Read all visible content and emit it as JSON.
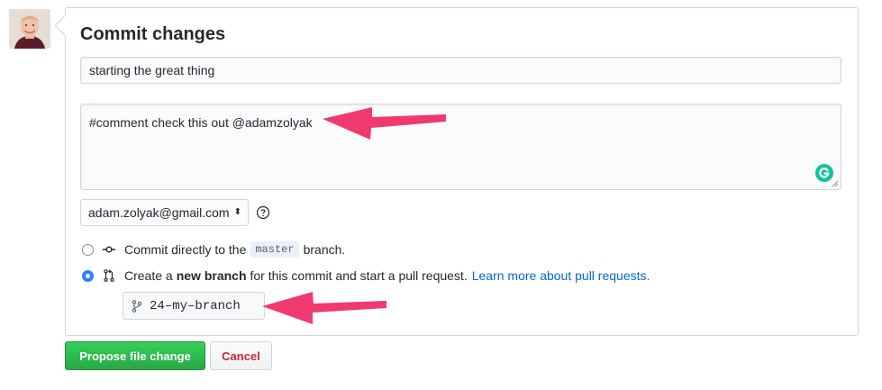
{
  "commit": {
    "title": "Commit changes",
    "summary_value": "starting the great thing",
    "description_value": "#comment check this out @adamzolyak",
    "email_value": "adam.zolyak@gmail.com",
    "email_caret": "⬍",
    "option_direct": {
      "prefix": "Commit directly to the",
      "branch_code": "master",
      "suffix": "branch."
    },
    "option_new_branch": {
      "prefix": "Create a",
      "bold": "new branch",
      "suffix": "for this commit and start a pull request.",
      "link": "Learn more about pull requests."
    },
    "branch_name_value": "24–my–branch"
  },
  "buttons": {
    "propose_label": "Propose file change",
    "cancel_label": "Cancel"
  },
  "icons": {
    "help": "question-circle-icon",
    "commit": "git-commit-icon",
    "pull_request": "git-pull-request-icon",
    "branch": "git-branch-icon",
    "grammarly": "grammarly-icon"
  },
  "colors": {
    "primary_green": "#2ea44f",
    "cancel_red": "#cb2431",
    "link_blue": "#0366d6",
    "annotation_arrow": "#f0396e",
    "radio_checked": "#2f80f5"
  }
}
